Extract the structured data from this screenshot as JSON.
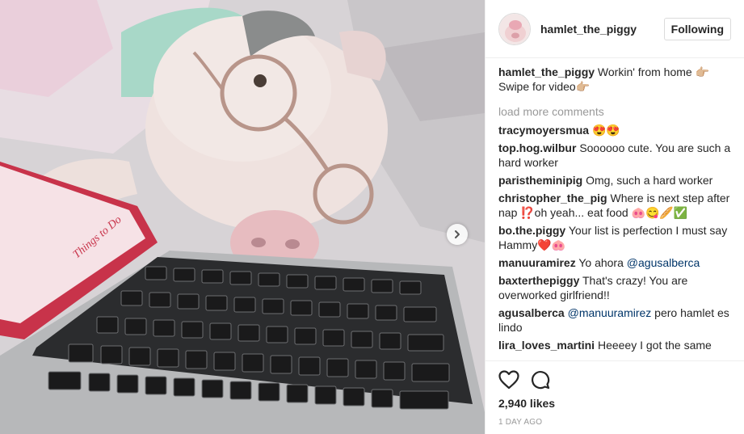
{
  "post": {
    "username": "hamlet_the_piggy",
    "follow_label": "Following"
  },
  "caption": {
    "username": "hamlet_the_piggy",
    "text": "Workin' from home 👉🏼 Swipe for video👉🏼"
  },
  "load_more": "load more comments",
  "comments": [
    {
      "user": "tracymoyersmua",
      "text": "😍😍"
    },
    {
      "user": "top.hog.wilbur",
      "text": "Soooooo cute. You are such a hard worker"
    },
    {
      "user": "paristheminipig",
      "text": "Omg, such a hard worker"
    },
    {
      "user": "christopher_the_pig",
      "text": "Where is next step after nap ⁉️oh yeah... eat food 🐽😋🥖✅"
    },
    {
      "user": "bo.the.piggy",
      "text": "Your list is perfection I must say Hammy❤️🐽"
    },
    {
      "user": "manuuramirez",
      "text": "Yo ahora",
      "mention": "@agusalberca",
      "after": ""
    },
    {
      "user": "baxterthepiggy",
      "text": "That's crazy! You are overworked girlfriend!!"
    },
    {
      "user": "agusalberca",
      "text": "",
      "mention": "@manuuramirez",
      "after": " pero hamlet es lindo"
    },
    {
      "user": "lira_loves_martini",
      "text": "Heeeey I got the same"
    }
  ],
  "likes": "2,940 likes",
  "time": "1 DAY AGO",
  "notebook_text": "Things to Do"
}
